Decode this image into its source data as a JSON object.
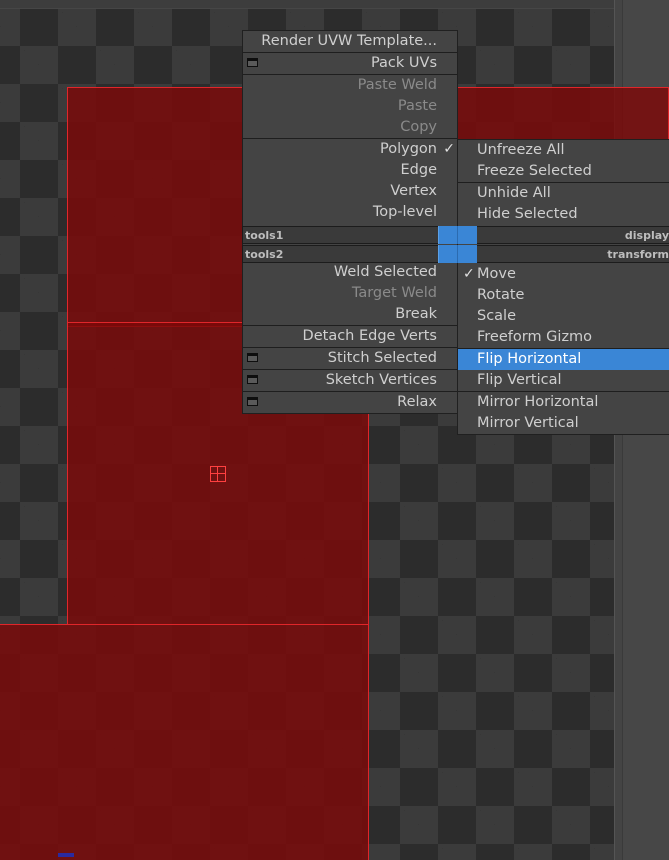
{
  "quad_menu": {
    "left": {
      "items": [
        {
          "label": "Render UVW Template...",
          "enabled": true
        },
        {
          "label": "Pack UVs",
          "enabled": true,
          "has_settings": true
        },
        {
          "label": "Paste Weld",
          "enabled": false
        },
        {
          "label": "Paste",
          "enabled": false
        },
        {
          "label": "Copy",
          "enabled": false
        },
        {
          "label": "Polygon",
          "enabled": true,
          "checked": true
        },
        {
          "label": "Edge",
          "enabled": true
        },
        {
          "label": "Vertex",
          "enabled": true
        },
        {
          "label": "Top-level",
          "enabled": true
        },
        {
          "label": "Weld Selected",
          "enabled": true
        },
        {
          "label": "Target Weld",
          "enabled": false
        },
        {
          "label": "Break",
          "enabled": true
        },
        {
          "label": "Detach Edge Verts",
          "enabled": true
        },
        {
          "label": "Stitch Selected",
          "enabled": true,
          "has_settings": true
        },
        {
          "label": "Sketch Vertices",
          "enabled": true,
          "has_settings": true
        },
        {
          "label": "Relax",
          "enabled": true,
          "has_settings": true
        }
      ]
    },
    "right": {
      "items": [
        {
          "label": "Unfreeze All",
          "enabled": true
        },
        {
          "label": "Freeze Selected",
          "enabled": true
        },
        {
          "label": "Unhide All",
          "enabled": true
        },
        {
          "label": "Hide Selected",
          "enabled": true
        },
        {
          "label": "Move",
          "enabled": true,
          "checked": true
        },
        {
          "label": "Rotate",
          "enabled": true
        },
        {
          "label": "Scale",
          "enabled": true
        },
        {
          "label": "Freeform Gizmo",
          "enabled": true
        },
        {
          "label": "Flip Horizontal",
          "enabled": true,
          "highlighted": true
        },
        {
          "label": "Flip Vertical",
          "enabled": true
        },
        {
          "label": "Mirror Horizontal",
          "enabled": true
        },
        {
          "label": "Mirror Vertical",
          "enabled": true
        }
      ]
    },
    "quadrant_labels": {
      "tools1": "tools1",
      "tools2": "tools2",
      "display": "display",
      "transform": "transform"
    },
    "check_glyph": "✓"
  },
  "colors": {
    "highlight": "#3a86d6",
    "uv_fill": "#7d0808",
    "uv_edge": "#e0262a",
    "menu_bg": "#444444"
  },
  "icons": [
    "settings-box-icon",
    "checkmark-icon",
    "transform-gizmo-icon"
  ]
}
